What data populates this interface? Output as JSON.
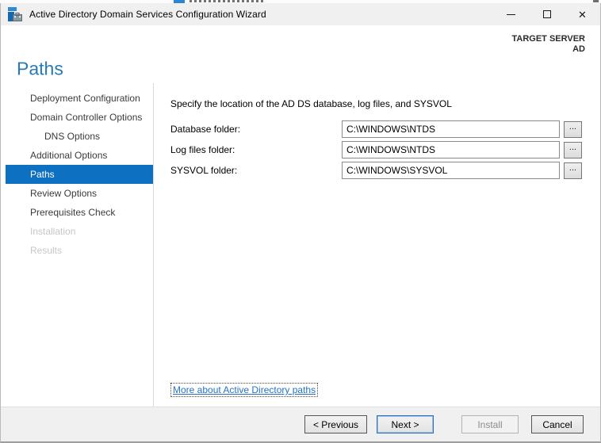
{
  "window": {
    "title": "Active Directory Domain Services Configuration Wizard",
    "icons": {
      "close_glyph": "✕"
    }
  },
  "header": {
    "page_title": "Paths",
    "target_server_label": "TARGET SERVER",
    "target_server_name": "AD"
  },
  "sidebar": {
    "items": [
      {
        "label": "Deployment Configuration",
        "state": "enabled"
      },
      {
        "label": "Domain Controller Options",
        "state": "enabled"
      },
      {
        "label": "DNS Options",
        "state": "enabled-sub"
      },
      {
        "label": "Additional Options",
        "state": "enabled"
      },
      {
        "label": "Paths",
        "state": "selected"
      },
      {
        "label": "Review Options",
        "state": "enabled"
      },
      {
        "label": "Prerequisites Check",
        "state": "enabled"
      },
      {
        "label": "Installation",
        "state": "disabled"
      },
      {
        "label": "Results",
        "state": "disabled"
      }
    ]
  },
  "content": {
    "instruction": "Specify the location of the AD DS database, log files, and SYSVOL",
    "fields": [
      {
        "label": "Database folder:",
        "value": "C:\\WINDOWS\\NTDS"
      },
      {
        "label": "Log files folder:",
        "value": "C:\\WINDOWS\\NTDS"
      },
      {
        "label": "SYSVOL folder:",
        "value": "C:\\WINDOWS\\SYSVOL"
      }
    ],
    "browse_label": "...",
    "more_link": "More about Active Directory paths"
  },
  "footer": {
    "previous_label": "< Previous",
    "next_label": "Next >",
    "install_label": "Install",
    "cancel_label": "Cancel"
  },
  "colors": {
    "accent_blue": "#0e70c0",
    "title_blue": "#2979b5",
    "link_blue": "#2573c2",
    "titlebar_bg": "#f0f0f0",
    "footer_bg": "#f0f0f0"
  }
}
